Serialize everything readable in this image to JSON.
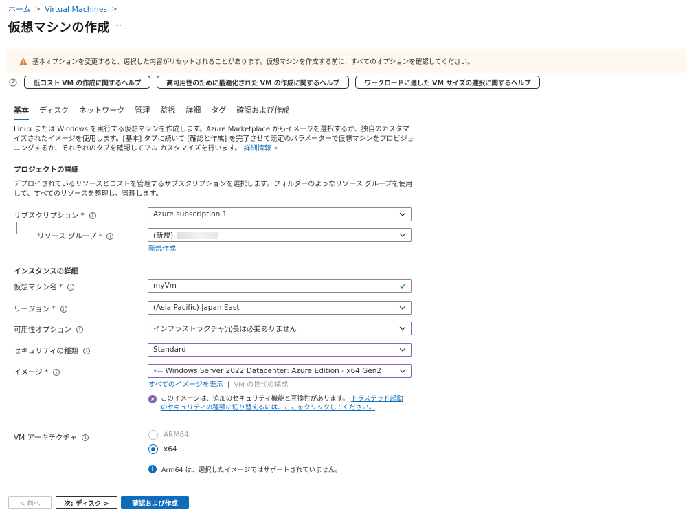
{
  "breadcrumb": {
    "home": "ホーム",
    "parent": "Virtual Machines"
  },
  "page": {
    "title": "仮想マシンの作成",
    "more": "···"
  },
  "warning": {
    "text": "基本オプションを変更すると、選択した内容がリセットされることがあります。仮想マシンを作成する前に、すべてのオプションを確認してください。"
  },
  "help": {
    "buttons": [
      "低コスト VM の作成に関するヘルプ",
      "高可用性のために最適化された VM の作成に関するヘルプ",
      "ワークロードに適した VM サイズの選択に関するヘルプ"
    ]
  },
  "tabs": [
    "基本",
    "ディスク",
    "ネットワーク",
    "管理",
    "監視",
    "詳細",
    "タグ",
    "確認および作成"
  ],
  "intro": {
    "text": "Linux または Windows を実行する仮想マシンを作成します。Azure Marketplace からイメージを選択するか、独自のカスタマイズされたイメージを使用します。[基本] タブに続いて [確認と作成] を完了させて既定のパラメーターで仮想マシンをプロビジョニングするか、それぞれのタブを確認してフル カスタマイズを行います。",
    "link": "詳細情報"
  },
  "project": {
    "title": "プロジェクトの詳細",
    "desc": "デプロイされているリソースとコストを管理するサブスクリプションを選択します。フォルダーのようなリソース グループを使用して、すべてのリソースを整理し、管理します。",
    "subscription_label": "サブスクリプション",
    "subscription_value": "Azure subscription 1",
    "rg_label": "リソース グループ",
    "rg_value": "(新規)",
    "rg_new": "新規作成"
  },
  "instance": {
    "title": "インスタンスの詳細",
    "vmname_label": "仮想マシン名",
    "vmname_value": "myVm",
    "region_label": "リージョン",
    "region_value": "(Asia Pacific) Japan East",
    "avail_label": "可用性オプション",
    "avail_value": "インフラストラクチャ冗長は必要ありません",
    "security_label": "セキュリティの種類",
    "security_value": "Standard",
    "image_label": "イメージ",
    "image_value": "Windows Server 2022 Datacenter: Azure Edition - x64 Gen2",
    "image_all": "すべてのイメージを表示",
    "image_sep": "|",
    "image_gen": "VM の世代の構成",
    "notice_text": "このイメージは、追加のセキュリティ機能と互換性があります。",
    "notice_link": "トラステッド起動のセキュリティの種類に切り替えるには、ここをクリックしてください。",
    "arch_label": "VM アーキテクチャ",
    "arch_arm": "ARM64",
    "arch_x64": "x64",
    "arch_note": "Arm64 は、選択したイメージではサポートされていません。"
  },
  "footer": {
    "prev": "< 前へ",
    "next": "次: ディスク >",
    "review": "確認および作成"
  },
  "colors": {
    "accent": "#0f6cbd",
    "warning_bg": "#fff8f0",
    "focus_purple": "#8764b8",
    "required": "#a4262c"
  }
}
